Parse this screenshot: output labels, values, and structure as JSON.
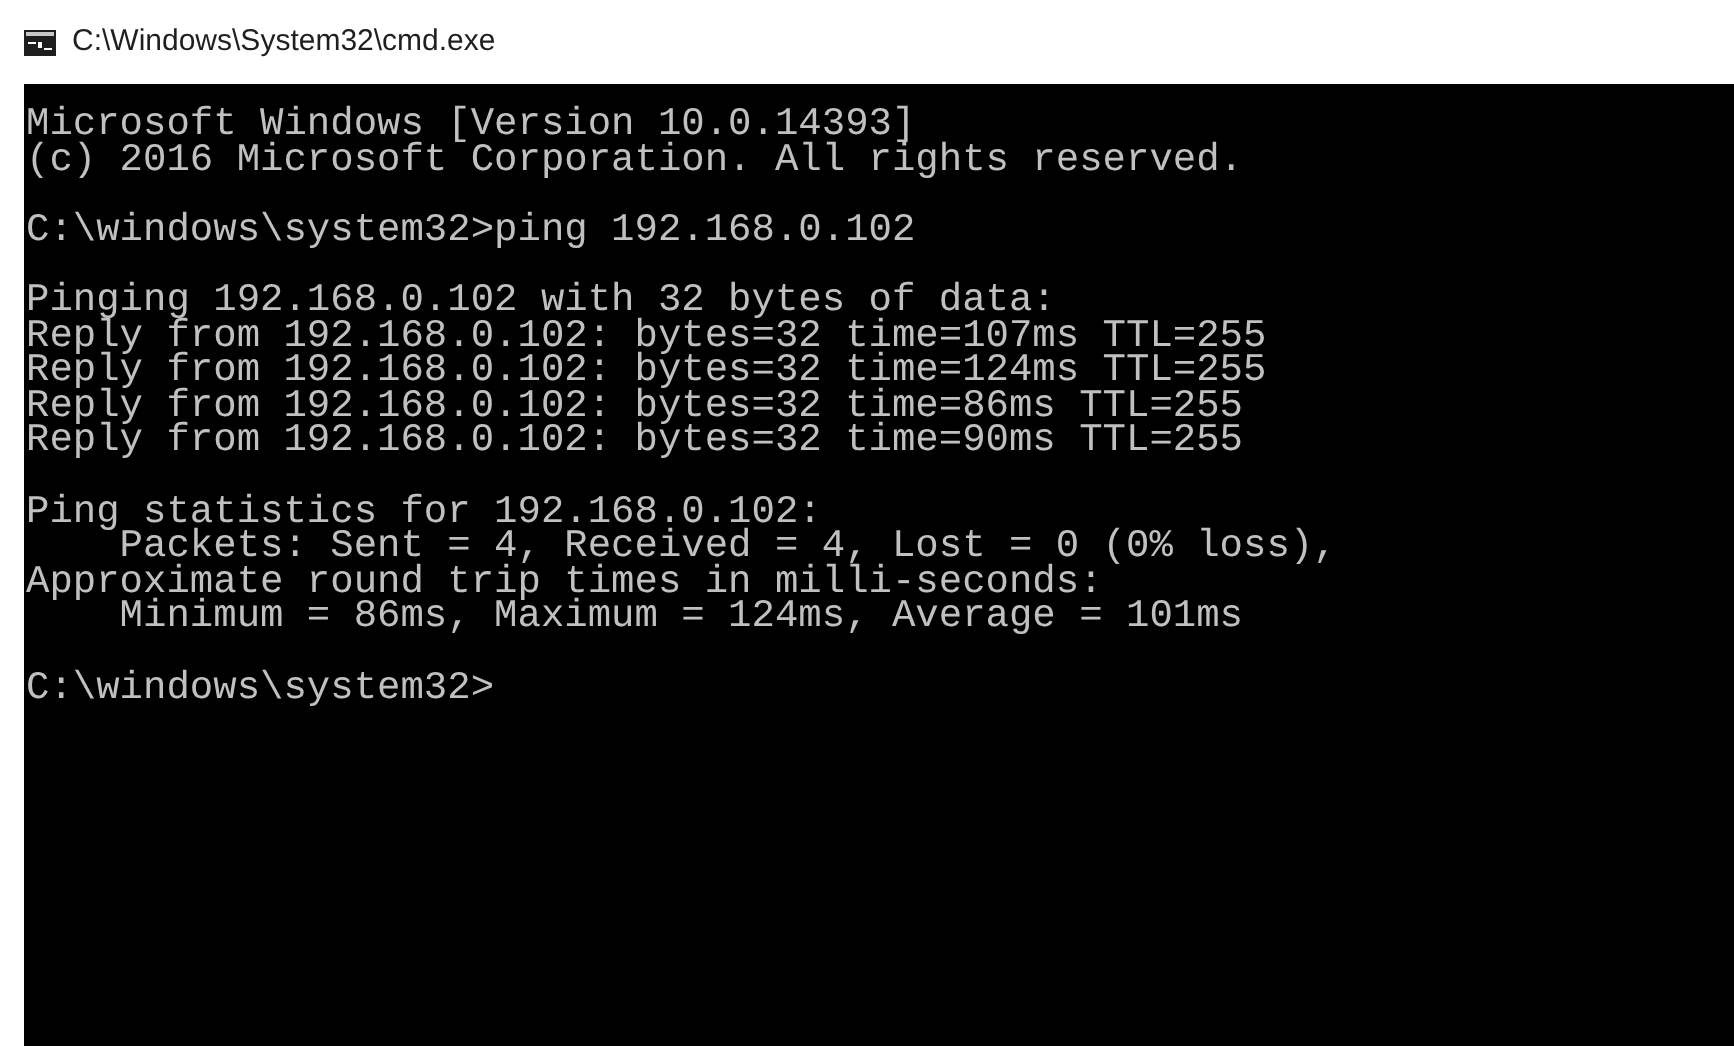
{
  "window": {
    "title": "C:\\Windows\\System32\\cmd.exe"
  },
  "console": {
    "blocks": [
      [
        "Microsoft Windows [Version 10.0.14393]",
        "(c) 2016 Microsoft Corporation. All rights reserved."
      ],
      [
        "C:\\windows\\system32>ping 192.168.0.102"
      ],
      [
        "Pinging 192.168.0.102 with 32 bytes of data:",
        "Reply from 192.168.0.102: bytes=32 time=107ms TTL=255",
        "Reply from 192.168.0.102: bytes=32 time=124ms TTL=255",
        "Reply from 192.168.0.102: bytes=32 time=86ms TTL=255",
        "Reply from 192.168.0.102: bytes=32 time=90ms TTL=255"
      ],
      [
        "Ping statistics for 192.168.0.102:",
        "    Packets: Sent = 4, Received = 4, Lost = 0 (0% loss),",
        "Approximate round trip times in milli-seconds:",
        "    Minimum = 86ms, Maximum = 124ms, Average = 101ms"
      ],
      [
        "C:\\windows\\system32>"
      ]
    ]
  }
}
